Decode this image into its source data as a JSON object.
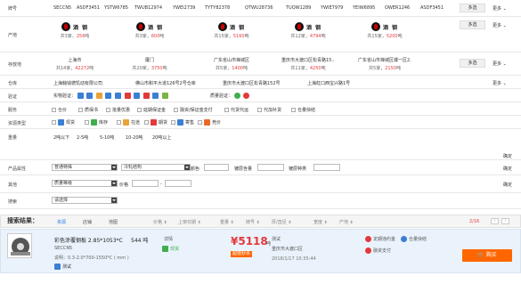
{
  "colors": {
    "accent": "#2a7ae2",
    "price": "#e4393c",
    "buy": "#ff6600"
  },
  "rows": {
    "grade": {
      "label": "牌号",
      "options": [
        "SECCN5",
        "ASDF3451",
        "YSTW6785",
        "TWUB12974",
        "YWEI2739",
        "TYTY82378",
        "QTWU28736",
        "TUQW1289",
        "YWIE7979",
        "YEIW6895",
        "OWER1246",
        "ASDF3451"
      ]
    },
    "origin": {
      "label": "产地",
      "brands": [
        {
          "logo": "酒 钢",
          "count": "3",
          "tons": "256"
        },
        {
          "logo": "酒 钢",
          "count": "3",
          "tons": "600"
        },
        {
          "logo": "酒 钢",
          "count": "15",
          "tons": "5160"
        },
        {
          "logo": "酒 钢",
          "count": "12",
          "tons": "4794"
        },
        {
          "logo": "酒 钢",
          "count": "15",
          "tons": "5200"
        }
      ]
    },
    "storage": {
      "label": "存放地",
      "locs": [
        {
          "name": "上海市",
          "count": "14",
          "tons": "42272"
        },
        {
          "name": "厦门",
          "count": "20",
          "tons": "3750"
        },
        {
          "name": "广东省山市禅城区",
          "count": "5",
          "tons": "1400"
        },
        {
          "name": "重庆市大渡口区松青路15...",
          "count": "11",
          "tons": "4250"
        },
        {
          "name": "广东省山市禅城区爆一区2...",
          "count": "5",
          "tons": "2150"
        }
      ]
    },
    "warehouse": {
      "label": "仓库",
      "items": [
        "上海翰钱德饥动有限公司",
        "佛山市和平大道126号2号仓库",
        "重庆市大渡口区松青路152号",
        "上海虹口西宝兴路1号"
      ]
    },
    "certify": {
      "label": "验证",
      "items": [
        "实物验证：",
        "质量验证："
      ]
    },
    "service": {
      "label": "服务",
      "items": [
        "仓价",
        "质保书",
        "批量优惠",
        "延期保证金",
        "融资/保证金支付",
        "代货代运",
        "代加补货",
        "仓量快结"
      ]
    },
    "resource": {
      "label": "资源类型",
      "items": [
        "现货",
        "库存",
        "在途",
        "期货",
        "寄售",
        "竞价"
      ]
    },
    "weight": {
      "label": "重量",
      "items": [
        "2吨以下",
        "2-5吨",
        "5-10吨",
        "10-20吨",
        "20吨以上"
      ]
    },
    "attrs": {
      "label": "产品属性",
      "select1": "普通特殊",
      "select2": "冷轧结构",
      "f1": "颜色",
      "f2": "镀层含量",
      "f3": "镀层种类"
    },
    "other": {
      "label": "其他",
      "select1": "质量等级",
      "f1": "价格",
      "f2": "-"
    },
    "search": {
      "label": "搜索",
      "select1": "请选择"
    }
  },
  "ui": {
    "multi": "多选",
    "more": "更多",
    "ok": "确定",
    "unit_jia": "共",
    "unit_tons": "吨",
    "unit_jia2": "家"
  },
  "results": {
    "label": "搜索结果：",
    "views": [
      "资源",
      "店铺",
      "地图"
    ],
    "sorts": [
      "价格 ⇟",
      "上架日期 ⇟",
      "重量 ⇟",
      "牌号 ⇟",
      "厚/直径 ⇟",
      "宽度 ⇟",
      "产地 ⇟"
    ],
    "page": "2/16",
    "item": {
      "title": "彩色涂覆钢板 2.85*1053*C",
      "weight": "544 吨",
      "grade": "SECCN5",
      "desc": "说明：0.3-2.0*700-1550*C ( mm )",
      "tag": "测试",
      "detail": "详情",
      "stock": "现货",
      "price": "¥5118",
      "price_unit": "吨",
      "seller": "测试",
      "promo": "超值秒杀",
      "address": "重庆市大渡口区",
      "time": "2018/1/17 10:35:44",
      "svc1": "定期违约金",
      "svc2": "仓量快结",
      "svc3": "融资支付",
      "buy": "购买"
    }
  }
}
